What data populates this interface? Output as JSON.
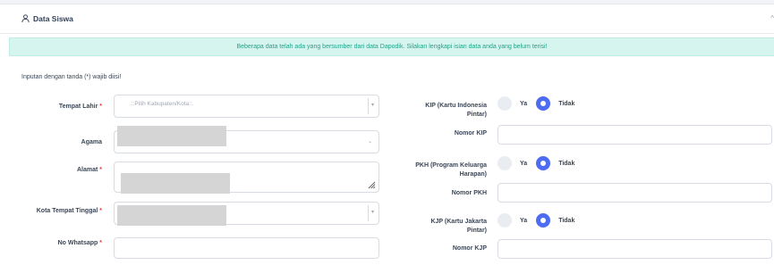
{
  "section": {
    "title": "Data Siswa",
    "collapse_symbol": "^"
  },
  "alert": {
    "text": "Beberapa data telah ada yang bersumber dari data Dapodik. Silakan lengkapi isian data anda yang belum terisi!"
  },
  "required_note": "Inputan dengan tanda (*) wajib diisi!",
  "required_mark": "*",
  "left_fields": {
    "tempat_lahir": {
      "label": "Tempat Lahir",
      "placeholder": ".::Pilih Kabupaten/Kota::."
    },
    "agama": {
      "label": "Agama"
    },
    "alamat": {
      "label": "Alamat"
    },
    "kota_tempat_tinggal": {
      "label": "Kota Tempat Tinggal"
    },
    "no_whatsapp": {
      "label": "No Whatsapp"
    }
  },
  "right_fields": {
    "kip": {
      "label_line1": "KIP (Kartu Indonesia",
      "label_line2": "Pintar)",
      "option_yes": "Ya",
      "option_no": "Tidak",
      "selected": "Tidak"
    },
    "nomor_kip": {
      "label": "Nomor KIP"
    },
    "pkh": {
      "label_line1": "PKH (Program Keluarga",
      "label_line2": "Harapan)",
      "option_yes": "Ya",
      "option_no": "Tidak",
      "selected": "Tidak"
    },
    "nomor_pkh": {
      "label": "Nomor PKH"
    },
    "kjp": {
      "label_line1": "KJP (Kartu Jakarta",
      "label_line2": "Pintar)",
      "option_yes": "Ya",
      "option_no": "Tidak",
      "selected": "Tidak"
    },
    "nomor_kjp": {
      "label": "Nomor KJP"
    }
  },
  "icons": {
    "section": "user-icon",
    "collapse": "chevron-up-icon",
    "select_caret": "chevron-down-icon",
    "textarea_resize": "resize-handle-icon"
  },
  "colors": {
    "alert_bg": "#d6f5ef",
    "alert_text": "#21a38a",
    "required": "#e53e3e",
    "radio_selected": "#4e6cf2"
  }
}
